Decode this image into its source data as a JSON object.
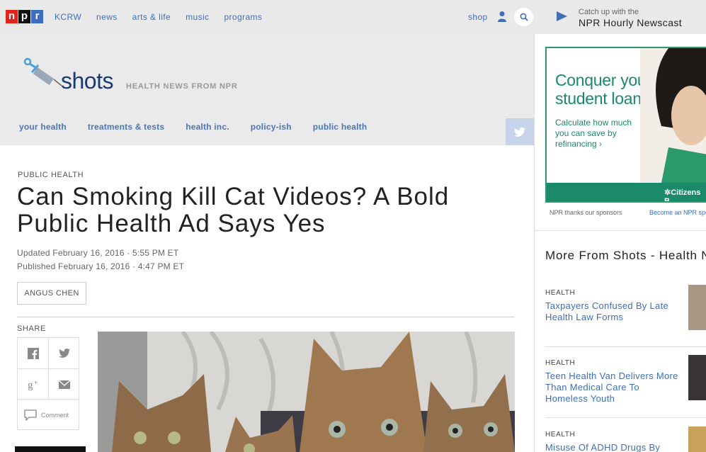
{
  "topnav": {
    "logo": [
      "n",
      "p",
      "r"
    ],
    "links": [
      "KCRW",
      "news",
      "arts & life",
      "music",
      "programs"
    ],
    "shop": "shop",
    "icons": [
      "user-icon",
      "search-icon"
    ]
  },
  "newscast": {
    "label": "Catch up with the",
    "title": "NPR Hourly Newscast",
    "icon": "play-icon"
  },
  "masthead": {
    "logo_text": "shots",
    "tagline": "HEALTH NEWS FROM NPR",
    "nav": [
      "your health",
      "treatments & tests",
      "health inc.",
      "policy-ish",
      "public health"
    ]
  },
  "article": {
    "slug": "PUBLIC HEALTH",
    "headline": "Can Smoking Kill Cat Videos? A Bold Public Health Ad Says Yes",
    "updated": "Updated February 16, 2016 · 5:55 PM ET",
    "published": "Published February 16, 2016 · 4:47 PM ET",
    "author": "ANGUS CHEN",
    "share_label": "SHARE",
    "comment_label": "Comment"
  },
  "ad": {
    "headline": "Conquer your student loans.",
    "sub": "Calculate how much you can save by refinancing ›",
    "brand": "✲Citizens B",
    "thanks": "NPR thanks our sponsors",
    "become": "Become an NPR sponsor"
  },
  "sidebar": {
    "title": "More From Shots - Health News",
    "stories": [
      {
        "tag": "HEALTH",
        "title": "Taxpayers Confused By Late Health Law Forms"
      },
      {
        "tag": "HEALTH",
        "title": "Teen Health Van Delivers More Than Medical Care To Homeless Youth"
      },
      {
        "tag": "HEALTH",
        "title": "Misuse Of ADHD Drugs By"
      }
    ]
  },
  "colors": {
    "npr_red": "#e2231a",
    "npr_blue": "#3c6dbf",
    "link_blue": "#3e6fb6",
    "ad_green": "#1a8a6a"
  }
}
